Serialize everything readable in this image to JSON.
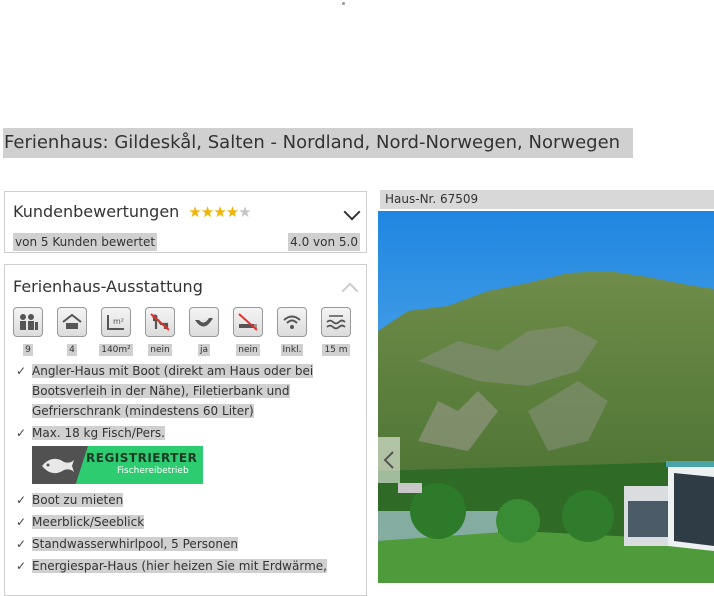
{
  "title": "Ferienhaus: Gildeskål, Salten - Nordland, Nord-Norwegen, Norwegen",
  "reviews": {
    "heading": "Kundenbewertungen",
    "stars_filled": 4,
    "stars_total": 5,
    "count_text": "von 5 Kunden bewertet",
    "score_text": "4.0 von 5.0"
  },
  "amenities": {
    "heading": "Ferienhaus-Ausstattung",
    "icons": [
      {
        "icon": "persons-icon",
        "value": "9"
      },
      {
        "icon": "bedroom-icon",
        "value": "4"
      },
      {
        "icon": "area-icon",
        "value": "140m²"
      },
      {
        "icon": "pets-icon",
        "value": "nein"
      },
      {
        "icon": "boat-icon",
        "value": "ja"
      },
      {
        "icon": "no-smoking-icon",
        "value": "nein"
      },
      {
        "icon": "wifi-icon",
        "value": "Inkl."
      },
      {
        "icon": "water-distance-icon",
        "value": "15 m"
      }
    ],
    "features": [
      "Angler-Haus mit Boot (direkt am Haus oder bei Bootsverleih in der Nähe), Filetierbank und Gefrierschrank (mindestens 60 Liter)",
      "Max. 18 kg Fisch/Pers.",
      "Boot zu mieten",
      "Meerblick/Seeblick",
      "Standwasserwhirlpool, 5 Personen",
      "Energiespar-Haus (hier heizen Sie mit Erdwärme,"
    ],
    "badge": {
      "line1": "REGISTRIERTER",
      "line2": "Fischereibetrieb"
    }
  },
  "house_number": "Haus-Nr. 67509",
  "colors": {
    "star": "#f2b400",
    "badge_green": "#2ecc71",
    "selection_gray": "#d0d0d0"
  }
}
